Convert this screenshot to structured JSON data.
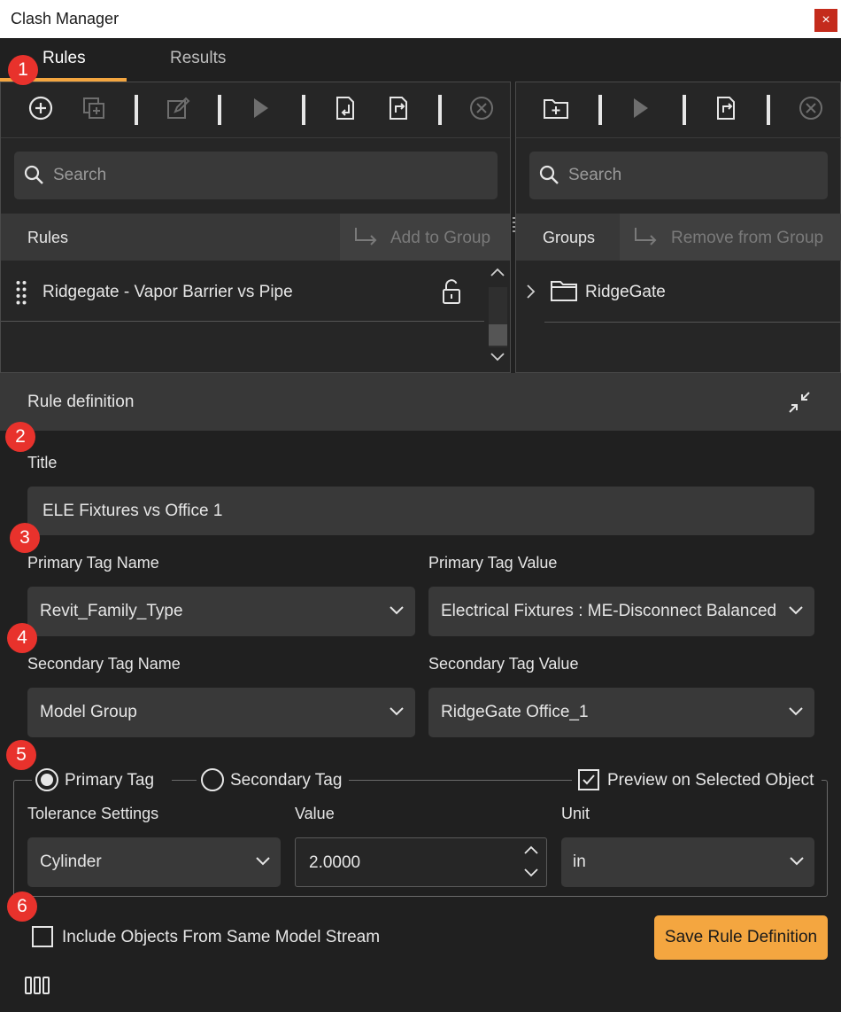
{
  "window": {
    "title": "Clash Manager",
    "close_glyph": "×"
  },
  "tabs": [
    {
      "label": "Rules",
      "active": true
    },
    {
      "label": "Results",
      "active": false
    }
  ],
  "rules_panel": {
    "toolbar": [
      "add-circle-icon",
      "duplicate-icon",
      "edit-icon",
      "play-icon",
      "import-icon",
      "export-icon",
      "delete-circle-icon"
    ],
    "search_placeholder": "Search",
    "header_label": "Rules",
    "add_to_group_label": "Add to Group",
    "items": [
      {
        "label": "Ridgegate - Vapor Barrier vs Pipe",
        "icon": "unlock-icon"
      }
    ]
  },
  "groups_panel": {
    "toolbar": [
      "new-folder-icon",
      "play-icon",
      "export-icon",
      "delete-circle-icon"
    ],
    "search_placeholder": "Search",
    "header_label": "Groups",
    "remove_from_group_label": "Remove from Group",
    "items": [
      {
        "label": "RidgeGate",
        "icon": "folder-icon"
      }
    ]
  },
  "rule_definition": {
    "header_label": "Rule definition",
    "title_label": "Title",
    "title_value": "ELE Fixtures vs Office 1",
    "primary_tag_name_label": "Primary Tag Name",
    "primary_tag_name_value": "Revit_Family_Type",
    "primary_tag_value_label": "Primary Tag Value",
    "primary_tag_value_value": "Electrical Fixtures : ME-Disconnect Balanced :",
    "secondary_tag_name_label": "Secondary Tag Name",
    "secondary_tag_name_value": "Model Group",
    "secondary_tag_value_label": "Secondary Tag Value",
    "secondary_tag_value_value": "RidgeGate Office_1",
    "radio_primary_label": "Primary Tag",
    "radio_secondary_label": "Secondary Tag",
    "preview_label": "Preview on Selected Object",
    "preview_checked": true,
    "tolerance_label": "Tolerance Settings",
    "tolerance_value": "Cylinder",
    "value_label": "Value",
    "value_value": "2.0000",
    "unit_label": "Unit",
    "unit_value": "in",
    "include_label": "Include Objects From Same Model Stream",
    "include_checked": false,
    "save_label": "Save Rule Definition"
  },
  "badges": [
    "1",
    "2",
    "3",
    "4",
    "5",
    "6"
  ],
  "colors": {
    "accent": "#f4a640",
    "badge": "#e8322c",
    "background": "#202020",
    "field": "#393939"
  }
}
